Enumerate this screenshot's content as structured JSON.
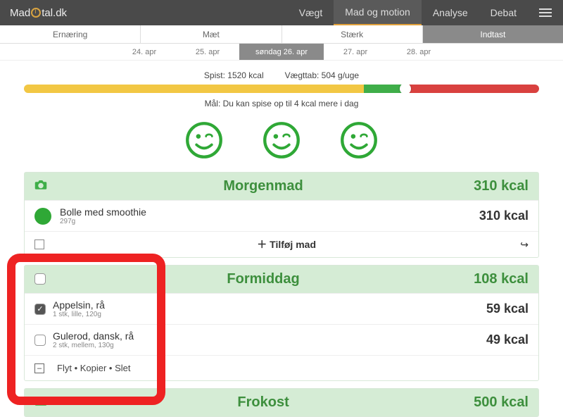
{
  "brand": {
    "pre": "Mad",
    "post": "tal.dk"
  },
  "nav": {
    "items": [
      {
        "label": "Vægt"
      },
      {
        "label": "Mad og motion",
        "active": true
      },
      {
        "label": "Analyse"
      },
      {
        "label": "Debat"
      }
    ]
  },
  "subtabs": [
    {
      "label": "Ernæring"
    },
    {
      "label": "Mæt"
    },
    {
      "label": "Stærk"
    },
    {
      "label": "Indtast",
      "active": true
    }
  ],
  "dates": [
    {
      "label": "24. apr"
    },
    {
      "label": "25. apr"
    },
    {
      "label": "søndag 26. apr",
      "active": true
    },
    {
      "label": "27. apr"
    },
    {
      "label": "28. apr"
    }
  ],
  "summary": {
    "eaten": "Spist: 1520 kcal",
    "loss": "Vægttab: 504 g/uge",
    "goal": "Mål: Du kan spise op til 4 kcal mere i dag"
  },
  "meals": [
    {
      "title": "Morgenmad",
      "kcal": "310 kcal",
      "rows": [
        {
          "name": "Bolle med smoothie",
          "sub": "297g",
          "kcal": "310 kcal",
          "dot": true
        }
      ],
      "add": {
        "label": "Tilføj mad"
      }
    },
    {
      "title": "Formiddag",
      "kcal": "108 kcal",
      "head_checkbox": true,
      "rows": [
        {
          "name": "Appelsin, rå",
          "sub": "1 stk, lille, 120g",
          "kcal": "59 kcal",
          "checked": true
        },
        {
          "name": "Gulerod, dansk, rå",
          "sub": "2 stk, mellem, 130g",
          "kcal": "49 kcal",
          "checked": false
        }
      ],
      "actions": {
        "flyt": "Flyt",
        "kopier": "Kopier",
        "slet": "Slet"
      }
    },
    {
      "title": "Frokost",
      "kcal": "500 kcal"
    }
  ]
}
